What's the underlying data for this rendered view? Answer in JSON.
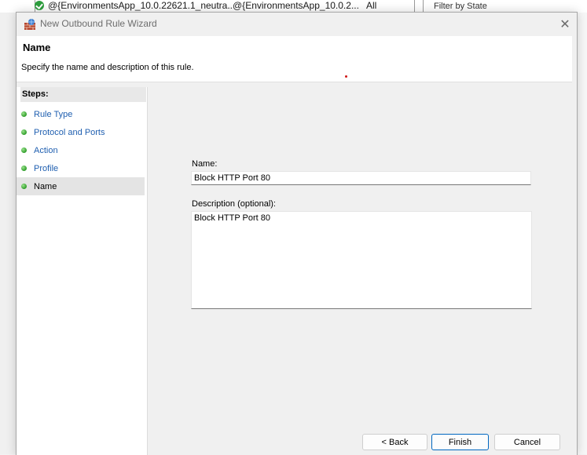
{
  "background_app": {
    "row_name": "@{EnvironmentsApp_10.0.22621.1_neutra...",
    "row_group": "@{EnvironmentsApp_10.0.2...",
    "row_profile": "All",
    "right_text": "Filter by State"
  },
  "dialog": {
    "title": "New Outbound Rule Wizard",
    "close_glyph": "✕"
  },
  "header": {
    "title": "Name",
    "subtitle": "Specify the name and description of this rule."
  },
  "steps": {
    "title": "Steps:",
    "items": [
      {
        "label": "Rule Type"
      },
      {
        "label": "Protocol and Ports"
      },
      {
        "label": "Action"
      },
      {
        "label": "Profile"
      },
      {
        "label": "Name"
      }
    ]
  },
  "form": {
    "name_label": "Name:",
    "name_value": "Block HTTP Port 80",
    "description_label": "Description (optional):",
    "description_value": "Block HTTP Port 80"
  },
  "buttons": {
    "back": "< Back",
    "finish": "Finish",
    "cancel": "Cancel"
  },
  "colors": {
    "accent": "#0067c0",
    "link": "#1f5fb0",
    "step_dot": "#2f9d2a"
  }
}
